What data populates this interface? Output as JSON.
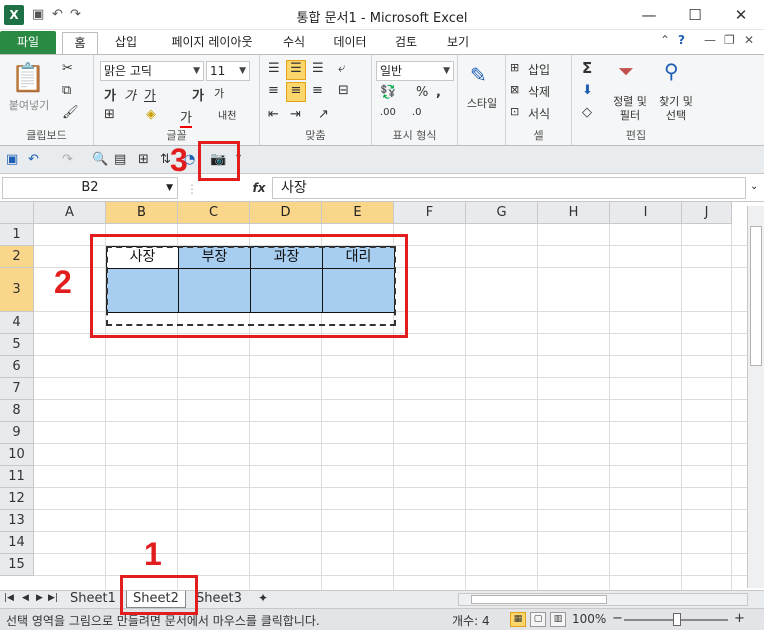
{
  "window": {
    "title": "통합 문서1  -  Microsoft Excel",
    "app_icon": "X",
    "min": "—",
    "max": "☐",
    "close": "✕"
  },
  "ribbon_tabs": [
    "파일",
    "홈",
    "삽입",
    "페이지 레이아웃",
    "수식",
    "데이터",
    "검토",
    "보기"
  ],
  "ribbon": {
    "clipboard": {
      "paste": "붙여넣기",
      "label": "클립보드"
    },
    "font": {
      "name": "맑은 고딕",
      "size": "11",
      "bold": "가",
      "italic": "가",
      "underline": "가",
      "grow": "가",
      "shrink": "가",
      "phonetic": "내천",
      "font_color": "가",
      "label": "글꼴"
    },
    "alignment": {
      "label": "맞춤"
    },
    "number": {
      "format": "일반",
      "percent": "%",
      "comma": ",",
      "label": "표시 형식"
    },
    "styles": {
      "label": "스타일"
    },
    "cells": {
      "insert": "삽입",
      "delete": "삭제",
      "format": "서식",
      "label": "셀"
    },
    "editing": {
      "sigma": "Σ",
      "sort1": "정렬 및",
      "sort2": "필터",
      "find1": "찾기 및",
      "find2": "선택",
      "label": "편집"
    }
  },
  "formula_bar": {
    "name_box": "B2",
    "fx": "fx",
    "value": "사장"
  },
  "columns": [
    "A",
    "B",
    "C",
    "D",
    "E",
    "F",
    "G",
    "H",
    "I",
    "J"
  ],
  "rows": [
    "1",
    "2",
    "3",
    "4",
    "5",
    "6",
    "7",
    "8",
    "9",
    "10",
    "11",
    "12",
    "13",
    "14",
    "15"
  ],
  "table": {
    "headers": [
      "사장",
      "부장",
      "과장",
      "대리"
    ]
  },
  "sheets": [
    "Sheet1",
    "Sheet2",
    "Sheet3"
  ],
  "status": {
    "message": "선택 영역을 그림으로 만들려면 문서에서 마우스를 클릭합니다.",
    "count": "개수: 4",
    "zoom": "100%",
    "zoom_minus": "−",
    "zoom_plus": "+"
  },
  "annotations": [
    "1",
    "2",
    "3"
  ],
  "colors": {
    "annotation": "#e21d1d",
    "header_fill": "#a7cdf0",
    "file_tab": "#2a8a44",
    "selected_header": "#f9d68a"
  }
}
